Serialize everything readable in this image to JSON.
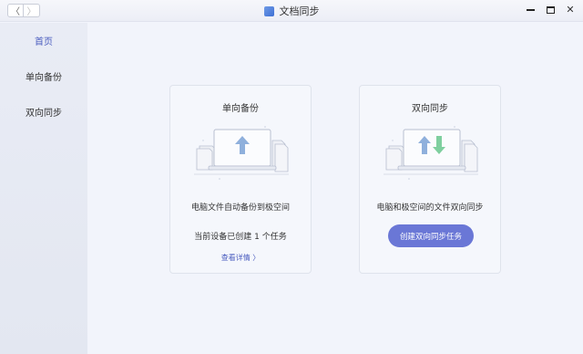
{
  "window": {
    "title": "文档同步",
    "back_glyph": "〈",
    "forward_glyph": "〉",
    "close_glyph": "✕"
  },
  "sidebar": {
    "items": [
      {
        "label": "首页",
        "active": true
      },
      {
        "label": "单向备份",
        "active": false
      },
      {
        "label": "双向同步",
        "active": false
      }
    ]
  },
  "cards": {
    "backup": {
      "title": "单向备份",
      "description": "电脑文件自动备份到极空间",
      "status": "当前设备已创建 1 个任务",
      "link_label": "查看详情 〉"
    },
    "sync": {
      "title": "双向同步",
      "description": "电脑和极空间的文件双向同步",
      "button_label": "创建双向同步任务"
    }
  },
  "colors": {
    "accent": "#4a5dbf",
    "button": "#6a77d6",
    "arrow_up": "#8fb0dc",
    "arrow_down": "#7fcf9f"
  }
}
